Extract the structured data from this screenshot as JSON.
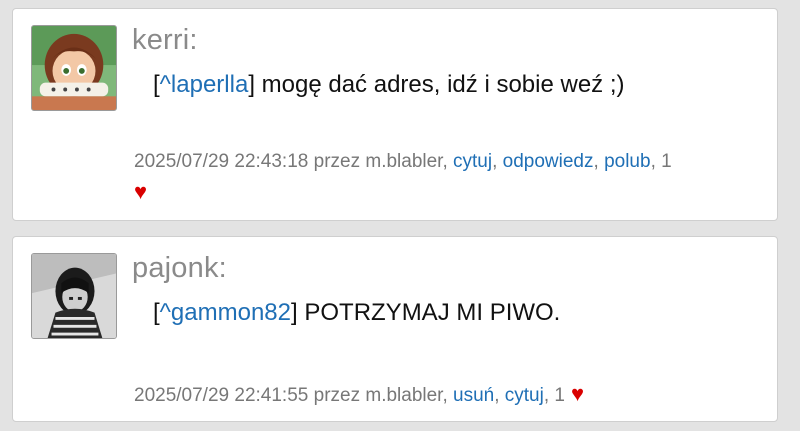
{
  "comments": [
    {
      "username": "kerri:",
      "message_prefix_open": "[",
      "message_mention": "^laperlla",
      "message_prefix_close": "]",
      "message_text": " mogę dać adres, idź i sobie weź ;)",
      "meta_datetime": "2025/07/29 22:43:18",
      "meta_by": " przez m.blabler, ",
      "actions": [
        "cytuj",
        "odpowiedz",
        "polub"
      ],
      "like_count": "1",
      "heart": "♥"
    },
    {
      "username": "pajonk:",
      "message_prefix_open": "[",
      "message_mention": "^gammon82",
      "message_prefix_close": "]",
      "message_text": " POTRZYMAJ MI PIWO.",
      "meta_datetime": "2025/07/29 22:41:55",
      "meta_by": " przez m.blabler, ",
      "actions": [
        "usuń",
        "cytuj"
      ],
      "like_count": "1",
      "heart": "♥"
    }
  ],
  "colors": {
    "link": "#1f6fb5",
    "heart": "#d90000",
    "username": "#8a8a8a",
    "meta": "#777777",
    "background": "#e3e3e3"
  }
}
